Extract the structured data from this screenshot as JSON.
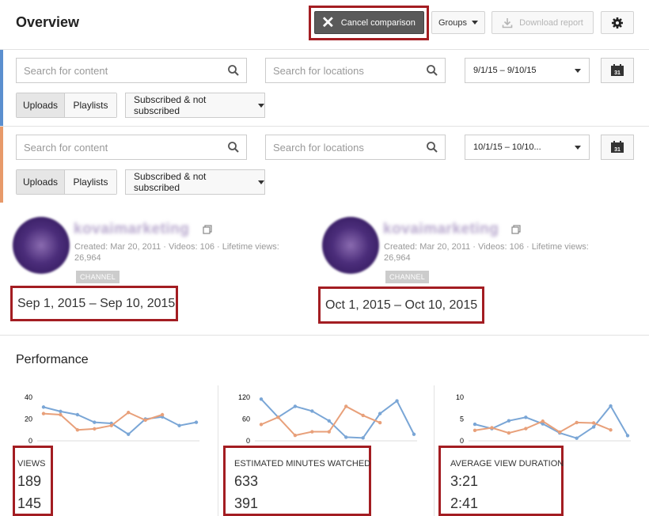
{
  "header": {
    "title": "Overview",
    "cancel_label": "Cancel comparison",
    "groups_label": "Groups",
    "download_label": "Download report"
  },
  "filters": [
    {
      "accent": "#5b8fcf",
      "search_content_placeholder": "Search for content",
      "search_locations_placeholder": "Search for locations",
      "date_range": "9/1/15 – 9/10/15",
      "calendar_day": "31",
      "uploads_label": "Uploads",
      "playlists_label": "Playlists",
      "subscribed_label": "Subscribed & not subscribed"
    },
    {
      "accent": "#e89a6a",
      "search_content_placeholder": "Search for content",
      "search_locations_placeholder": "Search for locations",
      "date_range": "10/1/15 – 10/10...",
      "calendar_day": "31",
      "uploads_label": "Uploads",
      "playlists_label": "Playlists",
      "subscribed_label": "Subscribed & not subscribed"
    }
  ],
  "channels": [
    {
      "name": "kovaimarketing",
      "created": "Created: Mar 20, 2011",
      "videos": "Videos: 106",
      "lifetime_label": "Lifetime views:",
      "lifetime_views": "26,964",
      "tag": "CHANNEL",
      "range": "Sep 1, 2015 – Sep 10, 2015"
    },
    {
      "name": "kovaimarketing",
      "created": "Created: Mar 20, 2011",
      "videos": "Videos: 106",
      "lifetime_label": "Lifetime views:",
      "lifetime_views": "26,964",
      "tag": "CHANNEL",
      "range": "Oct 1, 2015 – Oct 10, 2015"
    }
  ],
  "performance": {
    "title": "Performance",
    "metrics": [
      {
        "label": "VIEWS",
        "value_1": "189",
        "value_2": "145"
      },
      {
        "label": "ESTIMATED MINUTES WATCHED",
        "value_1": "633",
        "value_2": "391"
      },
      {
        "label": "AVERAGE VIEW DURATION",
        "value_1": "3:21",
        "value_2": "2:41"
      }
    ]
  },
  "colors": {
    "series_1": "#7aa6d6",
    "series_2": "#e8a07a",
    "highlight": "#a31d22"
  },
  "chart_data": [
    {
      "type": "line",
      "x": [
        1,
        2,
        3,
        4,
        5,
        6,
        7,
        8,
        9,
        10
      ],
      "yticks": [
        "0",
        "20",
        "40"
      ],
      "ylim": [
        0,
        40
      ],
      "series": [
        {
          "values": [
            31,
            27,
            24,
            17,
            16,
            6,
            20,
            22,
            14,
            17
          ]
        },
        {
          "values": [
            25,
            24,
            10,
            11,
            14,
            26,
            19,
            24
          ]
        }
      ]
    },
    {
      "type": "line",
      "x": [
        1,
        2,
        3,
        4,
        5,
        6,
        7,
        8,
        9,
        10
      ],
      "yticks": [
        "0",
        "60",
        "120"
      ],
      "ylim": [
        0,
        120
      ],
      "series": [
        {
          "values": [
            115,
            65,
            95,
            82,
            55,
            10,
            8,
            75,
            110,
            18
          ]
        },
        {
          "values": [
            45,
            65,
            15,
            25,
            25,
            95,
            70,
            50
          ]
        }
      ]
    },
    {
      "type": "line",
      "x": [
        1,
        2,
        3,
        4,
        5,
        6,
        7,
        8,
        9,
        10
      ],
      "yticks": [
        "0",
        "5",
        "10"
      ],
      "ylim": [
        0,
        10
      ],
      "series": [
        {
          "values": [
            3.8,
            2.8,
            4.6,
            5.4,
            3.9,
            1.8,
            0.6,
            3.2,
            8.0,
            1.2
          ]
        },
        {
          "values": [
            2.4,
            3.0,
            1.8,
            2.8,
            4.5,
            2.0,
            4.2,
            4.1,
            2.5
          ]
        }
      ]
    }
  ]
}
